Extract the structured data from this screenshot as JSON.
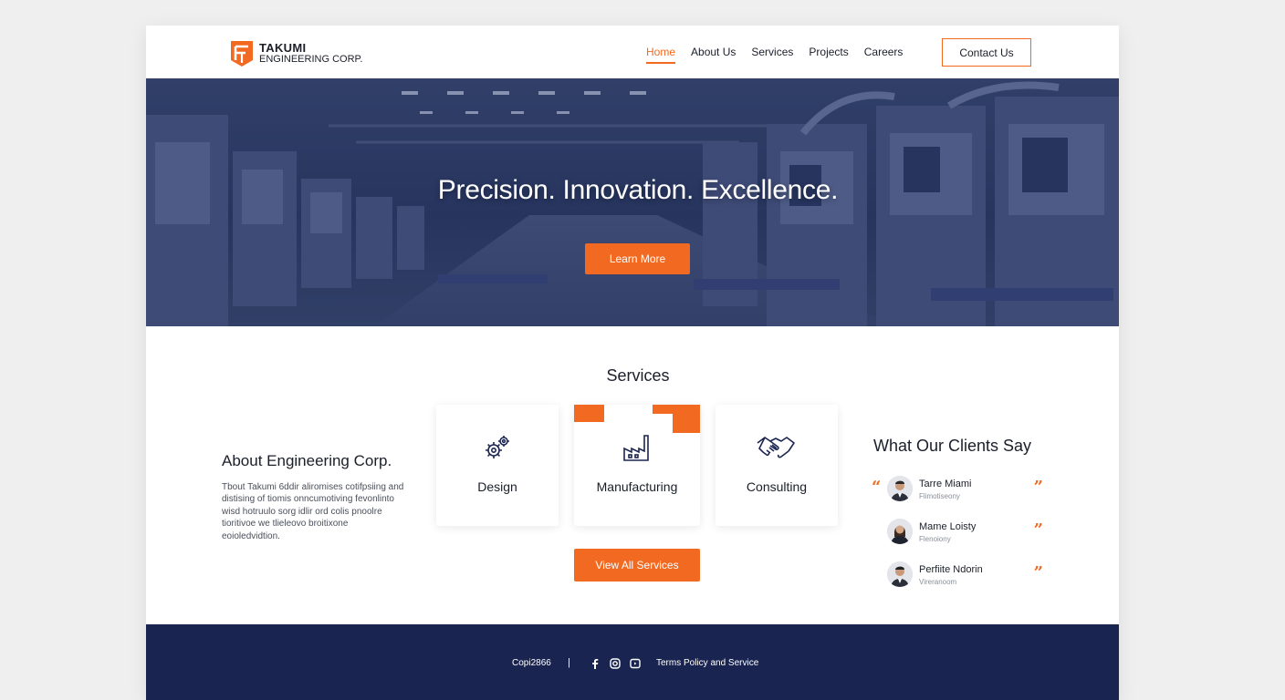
{
  "colors": {
    "accent": "#f26a21",
    "navy": "#192550",
    "hero": "#2b3861"
  },
  "header": {
    "logo_line1": "TAKUMI",
    "logo_line2": "ENGINEERING CORP.",
    "nav": [
      {
        "label": "Home",
        "active": true
      },
      {
        "label": "About Us",
        "active": false
      },
      {
        "label": "Services",
        "active": false
      },
      {
        "label": "Projects",
        "active": false
      },
      {
        "label": "Careers",
        "active": false
      }
    ],
    "contact_label": "Contact Us"
  },
  "hero": {
    "title": "Precision. Innovation. Excellence.",
    "cta_label": "Learn More"
  },
  "services": {
    "title": "Services",
    "cards": [
      {
        "label": "Design",
        "icon": "gears-icon"
      },
      {
        "label": "Manufacturing",
        "icon": "factory-icon"
      },
      {
        "label": "Consulting",
        "icon": "handshake-icon"
      }
    ],
    "view_all_label": "View All Services"
  },
  "about": {
    "title": "About Engineering Corp.",
    "text": "Tbout Takumi 6ddir aliromises cotifpsiing and distising of tiomis onncumotiving fevonlinto wisd hotruulo sorg idlir ord colis pnoolre tioritivoe we tlieleovo broitixone eoioledvidtion."
  },
  "clients": {
    "title": "What Our Clients Say",
    "items": [
      {
        "name": "Tarre Miami",
        "role": "Flimotiseony"
      },
      {
        "name": "Mame Loisty",
        "role": "Flenoiony"
      },
      {
        "name": "Perfiite Ndorin",
        "role": "Vireranoom"
      }
    ]
  },
  "footer": {
    "copyright": "Copi2866",
    "separator": "|",
    "social": [
      "facebook-icon",
      "instagram-icon",
      "youtube-icon"
    ],
    "links": "Terms Policy and Service"
  }
}
